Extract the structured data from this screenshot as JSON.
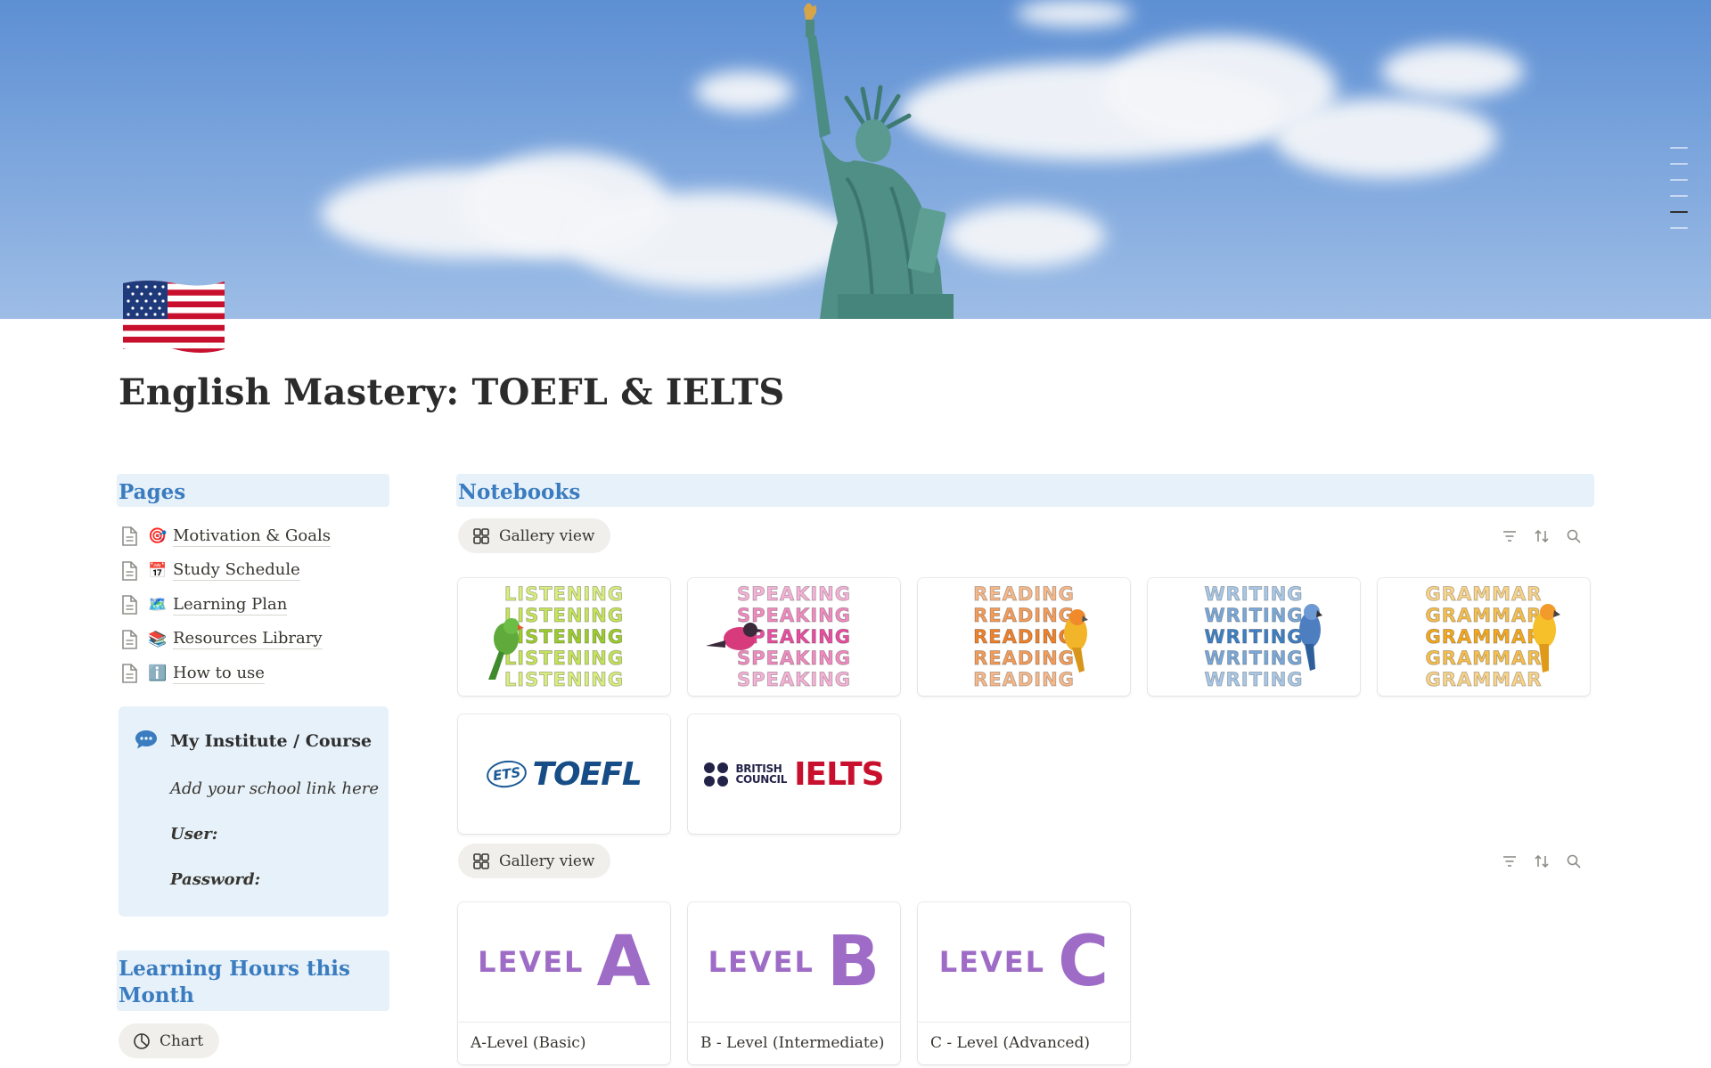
{
  "page": {
    "title": "English Mastery: TOEFL & IELTS",
    "icon": "us-flag-icon"
  },
  "sidebar": {
    "pages_heading": "Pages",
    "pages": [
      {
        "emoji": "🎯",
        "label": "Motivation & Goals"
      },
      {
        "emoji": "📅",
        "label": "Study Schedule"
      },
      {
        "emoji": "🗺️",
        "label": "Learning Plan"
      },
      {
        "emoji": "📚",
        "label": "Resources Library"
      },
      {
        "emoji": "ℹ️",
        "label": "How to use"
      }
    ],
    "callout": {
      "icon": "chat-bubble-icon",
      "title": "My Institute / Course",
      "link_hint": "Add your school link here",
      "user_label": "User:",
      "password_label": "Password:"
    },
    "hours_heading": "Learning Hours this Month",
    "chart_button": "Chart"
  },
  "notebooks": {
    "heading": "Notebooks",
    "gallery1": {
      "view_label": "Gallery view",
      "cards": [
        {
          "word": "LISTENING",
          "color": "#9ccd2a"
        },
        {
          "word": "SPEAKING",
          "color": "#e84fa0"
        },
        {
          "word": "READING",
          "color": "#f0822a"
        },
        {
          "word": "WRITING",
          "color": "#3f7fc4"
        },
        {
          "word": "GRAMMAR",
          "color": "#f4a81d"
        },
        {
          "logo": "TOEFL",
          "badge": "ETS"
        },
        {
          "logo": "IELTS",
          "badge_lines": [
            "BRITISH",
            "COUNCIL"
          ]
        }
      ]
    },
    "gallery2": {
      "view_label": "Gallery view",
      "cards": [
        {
          "level_word": "LEVEL",
          "letter": "A",
          "title": "A-Level (Basic)"
        },
        {
          "level_word": "LEVEL",
          "letter": "B",
          "title": "B - Level (Intermediate)"
        },
        {
          "level_word": "LEVEL",
          "letter": "C",
          "title": "C - Level (Advanced)"
        }
      ]
    }
  },
  "colors": {
    "heading_bg": "#e7f1fa",
    "heading_text": "#3a7cbf",
    "level_purple": "#9e6cc6"
  }
}
